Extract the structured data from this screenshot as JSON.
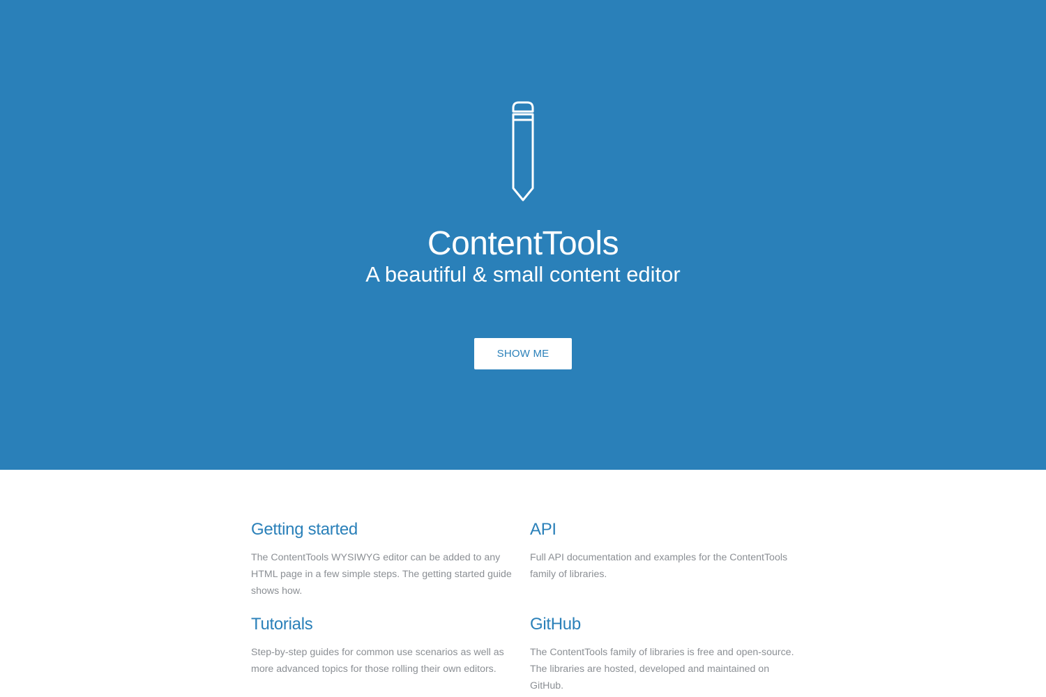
{
  "hero": {
    "title": "ContentTools",
    "subtitle": "A beautiful & small content editor",
    "cta_label": "SHOW ME",
    "icon": "pencil-icon",
    "background_color": "#2a80b9"
  },
  "features": [
    {
      "title": "Getting started",
      "description": "The ContentTools WYSIWYG editor can be added to any HTML page in a few simple steps. The getting started guide shows how."
    },
    {
      "title": "API",
      "description": "Full API documentation and examples for the ContentTools family of libraries."
    },
    {
      "title": "Tutorials",
      "description": "Step-by-step guides for common use scenarios as well as more advanced topics for those rolling their own editors."
    },
    {
      "title": "GitHub",
      "description": "The ContentTools family of libraries is free and open-source. The libraries are hosted, developed and maintained on GitHub."
    }
  ]
}
